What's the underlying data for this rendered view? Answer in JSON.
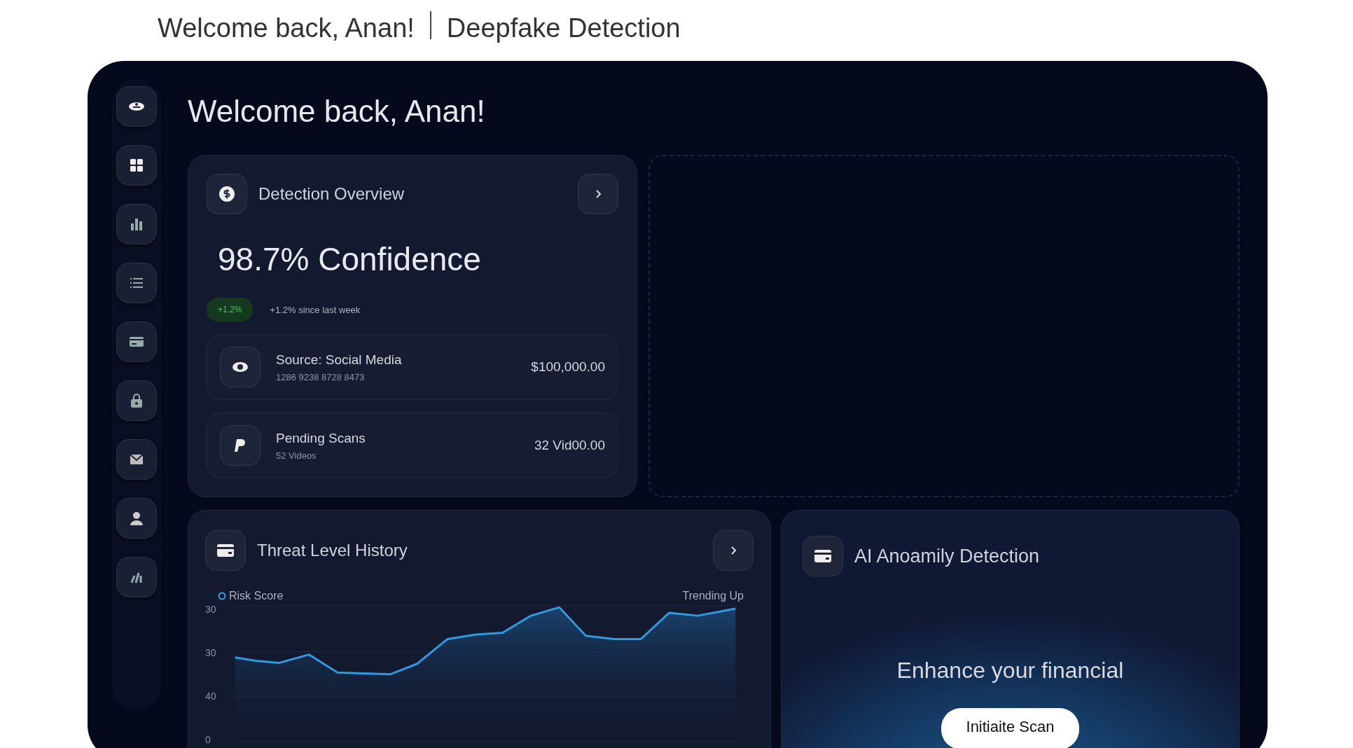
{
  "header": {
    "greeting": "Welcome back, Anan!",
    "product": "Deepfake Detection"
  },
  "page_title": "Welcome back, Anan!",
  "overview": {
    "title": "Detection Overview",
    "headline": "98.7% Confidence",
    "change_badge": "+1.2%",
    "change_note": "+1.2% since last week",
    "items": [
      {
        "kind": "source",
        "title": "Source: Social Media",
        "subtitle": "1286 9238 8728 8473",
        "amount": "$100,000.00"
      },
      {
        "kind": "pending",
        "title": "Pending Scans",
        "subtitle": "52 Videos",
        "amount": "32 Vid00.00"
      }
    ]
  },
  "threat": {
    "title": "Threat Level History",
    "legend": "Risk Score",
    "trend": "Trending Up",
    "y_tick_labels": [
      "30",
      "30",
      "40",
      "0"
    ]
  },
  "ai": {
    "title": "AI Anoamily Detection",
    "message": "Enhance your financial",
    "button": "Initiaite Scan"
  }
}
